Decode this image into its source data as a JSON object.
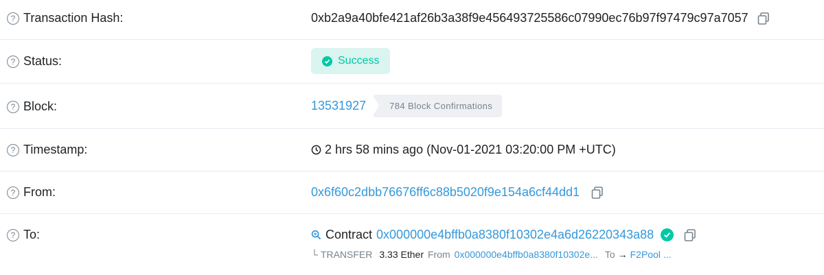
{
  "rows": {
    "tx_hash": {
      "label": "Transaction Hash:",
      "value": "0xb2a9a40bfe421af26b3a38f9e456493725586c07990ec76b97f97479c97a7057"
    },
    "status": {
      "label": "Status:",
      "value": "Success"
    },
    "block": {
      "label": "Block:",
      "value": "13531927",
      "confirmations": "784 Block Confirmations"
    },
    "timestamp": {
      "label": "Timestamp:",
      "value": "2 hrs 58 mins ago (Nov-01-2021 03:20:00 PM +UTC)"
    },
    "from": {
      "label": "From:",
      "value": "0x6f60c2dbb76676ff6c88b5020f9e154a6cf44dd1"
    },
    "to": {
      "label": "To:",
      "prefix": "Contract",
      "value": "0x000000e4bffb0a8380f10302e4a6d26220343a88",
      "transfer": {
        "branch": "└",
        "type": "TRANSFER",
        "amount": "3.33 Ether",
        "from_label": "From",
        "from_value": "0x000000e4bffb0a8380f10302e...",
        "to_label": "To",
        "arrow": "→",
        "to_value": "F2Pool ..."
      }
    }
  },
  "icons": {
    "help": "question-circle-icon",
    "copy": "copy-icon",
    "clock": "clock-icon",
    "check": "check-circle-icon",
    "search": "search-contract-icon"
  },
  "colors": {
    "link": "#3498db",
    "success": "#00c9a7",
    "success_bg": "#daf4ef",
    "muted": "#77838f",
    "divider": "#e7eaf3"
  }
}
